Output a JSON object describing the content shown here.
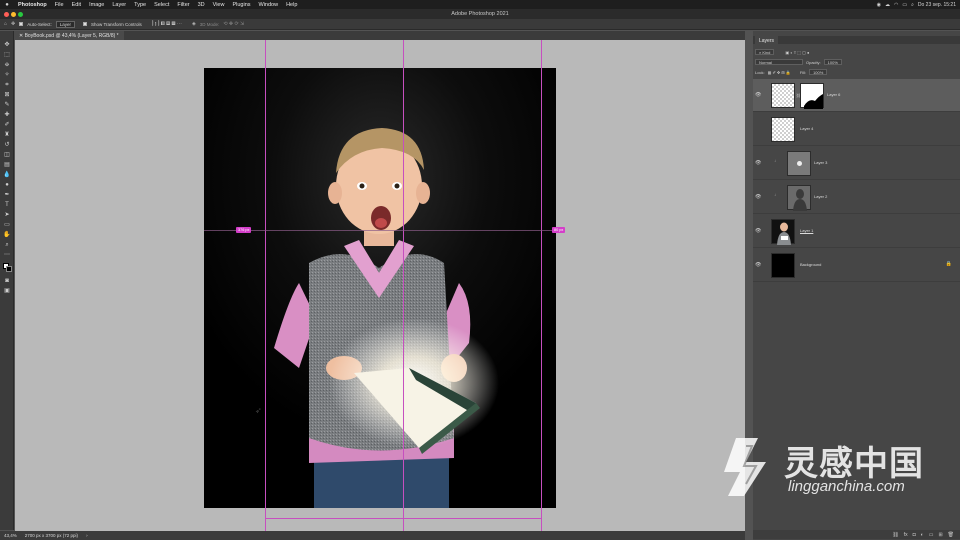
{
  "menubar": {
    "items": [
      "Photoshop",
      "File",
      "Edit",
      "Image",
      "Layer",
      "Type",
      "Select",
      "Filter",
      "3D",
      "View",
      "Plugins",
      "Window",
      "Help"
    ],
    "datetime": "Do 23 sep.  15:21"
  },
  "titlebar": {
    "title": "Adobe Photoshop 2021"
  },
  "options": {
    "auto_select_label": "Auto-Select:",
    "auto_select_value": "Layer",
    "transform_label": "Show Transform Controls",
    "mode_label": "3D Mode:"
  },
  "document": {
    "tab_label": "BoyBook.psd @ 43,4% (Layer 5, RGB/8) *",
    "measure_left": "376 px",
    "measure_right": "80 px"
  },
  "status": {
    "zoom": "43,4%",
    "size": "2700 px x 3700 px (72 ppi)"
  },
  "layers_panel": {
    "tab": "Layers",
    "kind_label": "Kind",
    "blend_mode": "Normal",
    "opacity_label": "Opacity:",
    "opacity_value": "100%",
    "lock_label": "Lock:",
    "fill_label": "Fill:",
    "fill_value": "100%",
    "layers": [
      {
        "name": "Layer 6"
      },
      {
        "name": "Layer 4"
      },
      {
        "name": "Layer 3"
      },
      {
        "name": "Layer 2"
      },
      {
        "name": "Layer 1"
      },
      {
        "name": "Background"
      }
    ]
  },
  "watermark": {
    "chinese": "灵感中国",
    "url": "lingganchina.com"
  },
  "colors": {
    "guide": "#c64fbf",
    "measure": "#d43ec9",
    "active_layer": "#5d5d5d"
  }
}
